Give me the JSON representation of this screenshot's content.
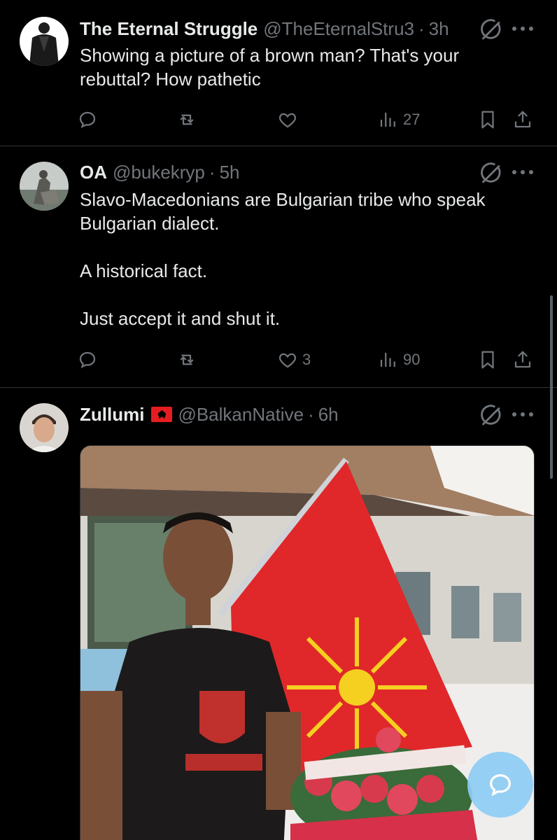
{
  "tweets": [
    {
      "name": "The Eternal Struggle",
      "handle": "@TheEternalStru3",
      "time": "3h",
      "text": "Showing a picture of a brown man? That's your rebuttal? How pathetic",
      "views": "27"
    },
    {
      "name": "OA",
      "handle": "@bukekryp",
      "time": "5h",
      "text": "Slavo-Macedonians are Bulgarian tribe who speak Bulgarian dialect.\n\nA historical fact.\n\nJust accept it and shut it.",
      "likes": "3",
      "views": "90"
    },
    {
      "name": "Zullumi",
      "handle": "@BalkanNative",
      "time": "6h",
      "flag_icon": "albania-flag-icon"
    }
  ],
  "separator": "·",
  "colors": {
    "background": "#000000",
    "text": "#e7e9ea",
    "muted": "#71767b",
    "divider": "#2f3336",
    "fab": "#8ecdf5",
    "flag_red": "#e41e20"
  },
  "icons": [
    "reply-icon",
    "retweet-icon",
    "like-icon",
    "views-icon",
    "bookmark-icon",
    "share-icon",
    "grok-icon",
    "more-icon",
    "compose-icon"
  ]
}
